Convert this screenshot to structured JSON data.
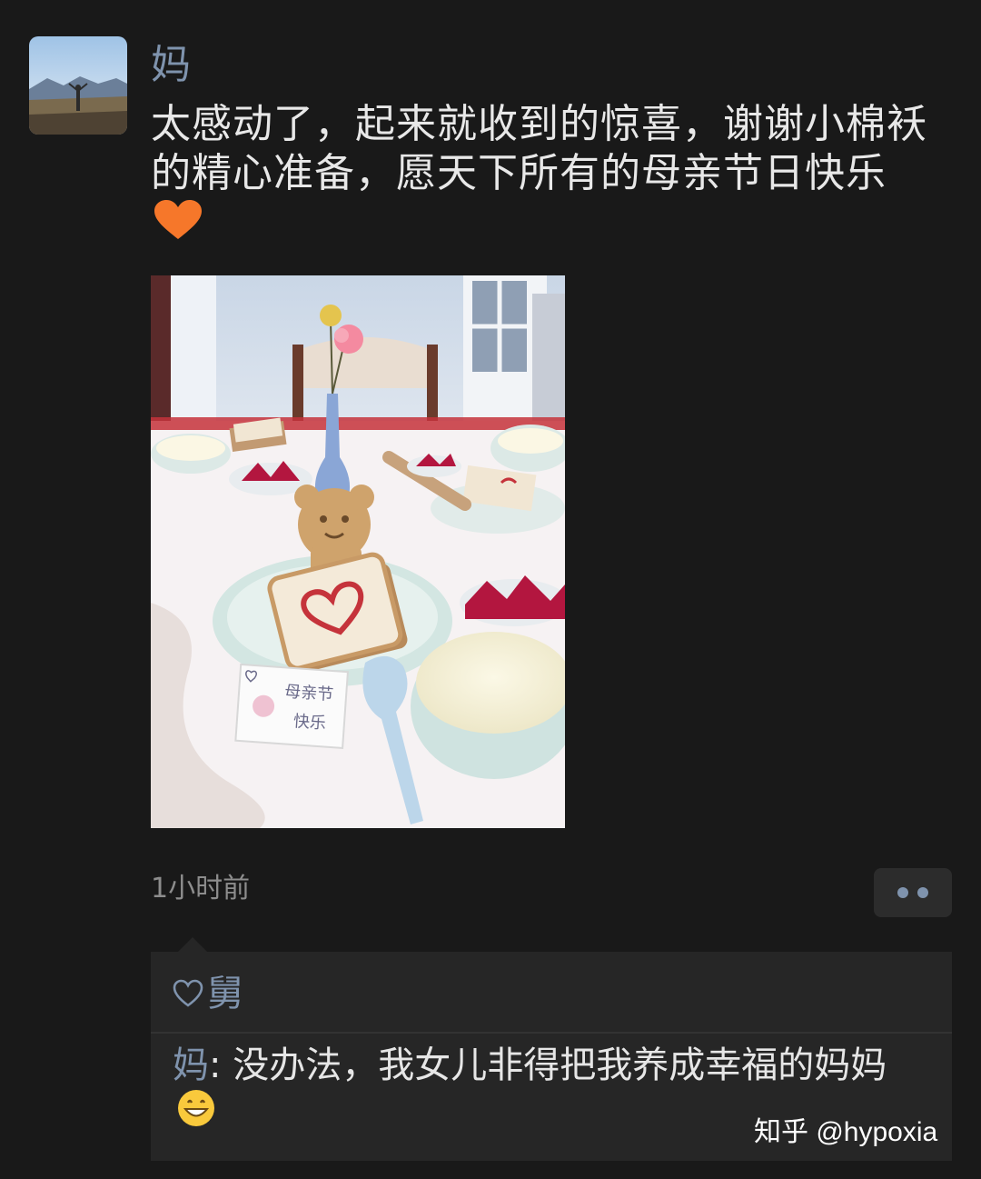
{
  "post": {
    "author": "妈",
    "text": "太感动了，起来就收到的惊喜，谢谢小棉袄的精心准备，愿天下所有的母亲节日快乐",
    "emoji": "orange-heart-emoji",
    "timestamp": "1小时前",
    "photo_note_line1": "母亲节",
    "photo_note_line2": "快乐"
  },
  "likes": {
    "names": "舅"
  },
  "comments": [
    {
      "author": "妈",
      "separator": ": ",
      "text": "没办法，我女儿非得把我养成幸福的妈妈",
      "emoji": "grinning-face-emoji"
    }
  ],
  "watermark": "知乎 @hypoxia",
  "colors": {
    "background": "#191919",
    "name_link": "#7f93ad",
    "text": "#e8e8e8",
    "comment_bg": "#262626",
    "timestamp": "#8d8d8d"
  }
}
